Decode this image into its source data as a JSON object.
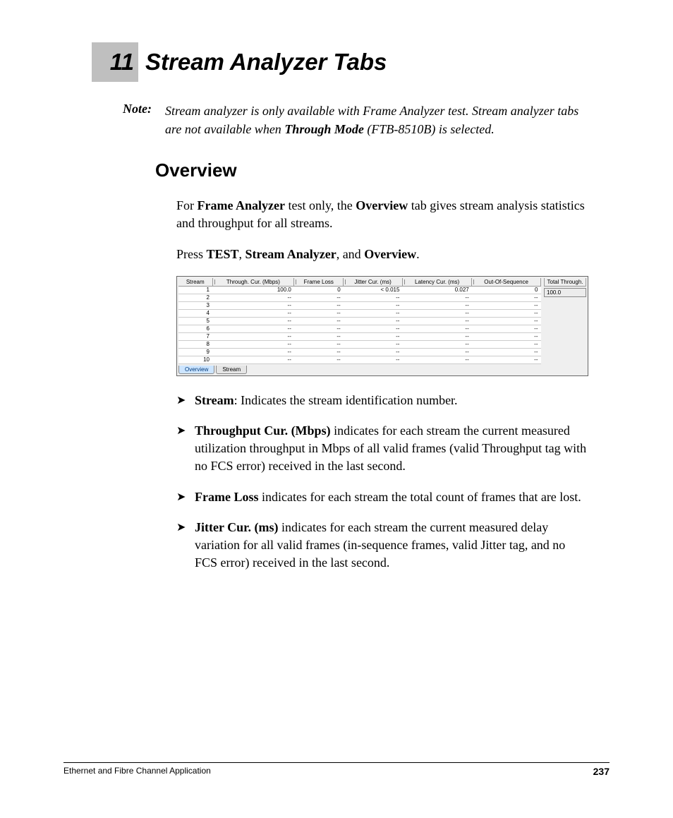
{
  "chapter": {
    "number": "11",
    "title": "Stream Analyzer Tabs"
  },
  "note": {
    "label": "Note:",
    "text_pre": "Stream analyzer is only available with Frame Analyzer test. Stream analyzer tabs are not available when ",
    "bold": "Through Mode",
    "text_post": " (FTB-8510B) is selected."
  },
  "section_heading": "Overview",
  "para1": {
    "t1": "For ",
    "b1": "Frame Analyzer",
    "t2": " test only, the ",
    "b2": "Overview",
    "t3": " tab gives stream analysis statistics and throughput for all streams."
  },
  "para2": {
    "t1": "Press ",
    "b1": "TEST",
    "t2": ", ",
    "b2": "Stream Analyzer",
    "t3": ", and ",
    "b3": "Overview",
    "t4": "."
  },
  "screenshot": {
    "headers": [
      "Stream",
      "Through. Cur. (Mbps)",
      "Frame Loss",
      "Jitter Cur. (ms)",
      "Latency Cur. (ms)",
      "Out-Of-Sequence"
    ],
    "rows": [
      [
        "1",
        "100.0",
        "0",
        "< 0.015",
        "0.027",
        "0"
      ],
      [
        "2",
        "--",
        "--",
        "--",
        "--",
        "--"
      ],
      [
        "3",
        "--",
        "--",
        "--",
        "--",
        "--"
      ],
      [
        "4",
        "--",
        "--",
        "--",
        "--",
        "--"
      ],
      [
        "5",
        "--",
        "--",
        "--",
        "--",
        "--"
      ],
      [
        "6",
        "--",
        "--",
        "--",
        "--",
        "--"
      ],
      [
        "7",
        "--",
        "--",
        "--",
        "--",
        "--"
      ],
      [
        "8",
        "--",
        "--",
        "--",
        "--",
        "--"
      ],
      [
        "9",
        "--",
        "--",
        "--",
        "--",
        "--"
      ],
      [
        "10",
        "--",
        "--",
        "--",
        "--",
        "--"
      ]
    ],
    "side_title": "Total Through.",
    "side_value": "100.0",
    "tabs": {
      "overview": "Overview",
      "stream": "Stream"
    }
  },
  "bullets": [
    {
      "b": "Stream",
      "text": ": Indicates the stream identification number."
    },
    {
      "b": "Throughput Cur. (Mbps)",
      "text": " indicates for each stream the current measured utilization throughput in Mbps of all valid frames (valid Throughput tag with no FCS error) received in the last second."
    },
    {
      "b": "Frame Loss",
      "text": " indicates for each stream the total count of frames that are lost."
    },
    {
      "b": "Jitter Cur. (ms)",
      "text": " indicates for each stream the current measured delay variation for all valid frames (in-sequence frames, valid Jitter tag, and no FCS error) received in the last second."
    }
  ],
  "footer": {
    "left": "Ethernet and Fibre Channel Application",
    "page": "237"
  }
}
